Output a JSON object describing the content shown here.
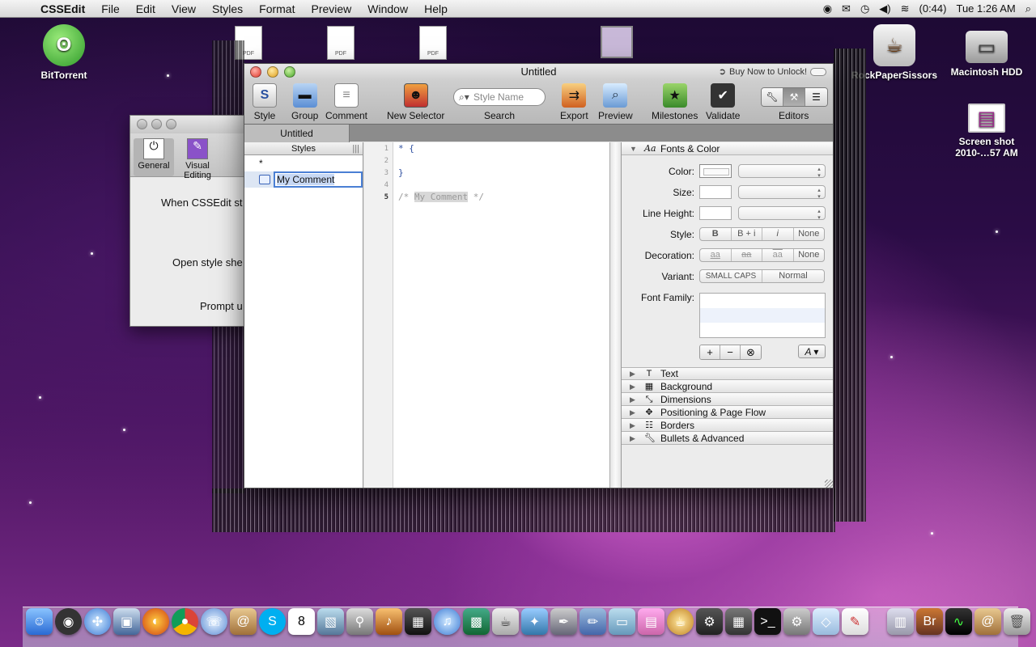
{
  "menubar": {
    "app_name": "CSSEdit",
    "items": [
      "File",
      "Edit",
      "View",
      "Styles",
      "Format",
      "Preview",
      "Window",
      "Help"
    ],
    "battery": "(0:44)",
    "clock": "Tue 1:26 AM"
  },
  "desktop": {
    "icons": [
      {
        "label": "BitTorrent"
      },
      {
        "label": "RockPaperSissors"
      },
      {
        "label": "Macintosh HDD"
      },
      {
        "label": "Screen shot 2010-…57 AM"
      }
    ],
    "pdf_label": "PDF"
  },
  "prefs_window": {
    "tabs": [
      "General",
      "Visual Editing"
    ],
    "lines": [
      "When CSSEdit st",
      "Open style she",
      "Prompt u"
    ]
  },
  "main_window": {
    "title": "Untitled",
    "buy_now": "Buy Now to Unlock!",
    "toolbar": {
      "style": "Style",
      "group": "Group",
      "comment": "Comment",
      "new_selector": "New Selector",
      "search_placeholder": "Style Name",
      "search": "Search",
      "export": "Export",
      "preview": "Preview",
      "milestones": "Milestones",
      "validate": "Validate",
      "editors": "Editors"
    },
    "doc_tab": "Untitled",
    "styles_pane": {
      "header": "Styles",
      "items": [
        "*"
      ],
      "selected_comment": "My Comment"
    },
    "code": {
      "line_numbers": [
        "1",
        "2",
        "3",
        "4",
        "5"
      ],
      "line1": "* {",
      "line3": "}",
      "comment_open": "/* ",
      "comment_text": "My Comment",
      "comment_close": " */"
    },
    "inspector": {
      "section": "Fonts & Color",
      "labels": {
        "color": "Color:",
        "size": "Size:",
        "line_height": "Line Height:",
        "style": "Style:",
        "decoration": "Decoration:",
        "variant": "Variant:",
        "font_family": "Font Family:"
      },
      "style_options": [
        "B",
        "B + i",
        "i",
        "None"
      ],
      "decoration_options": [
        "aa",
        "aa",
        "aa",
        "None"
      ],
      "variant_options": [
        "SMALL CAPS",
        "Normal"
      ],
      "font_button": "A",
      "collapsed_sections": [
        "Text",
        "Background",
        "Dimensions",
        "Positioning & Page Flow",
        "Borders",
        "Bullets & Advanced"
      ]
    }
  }
}
